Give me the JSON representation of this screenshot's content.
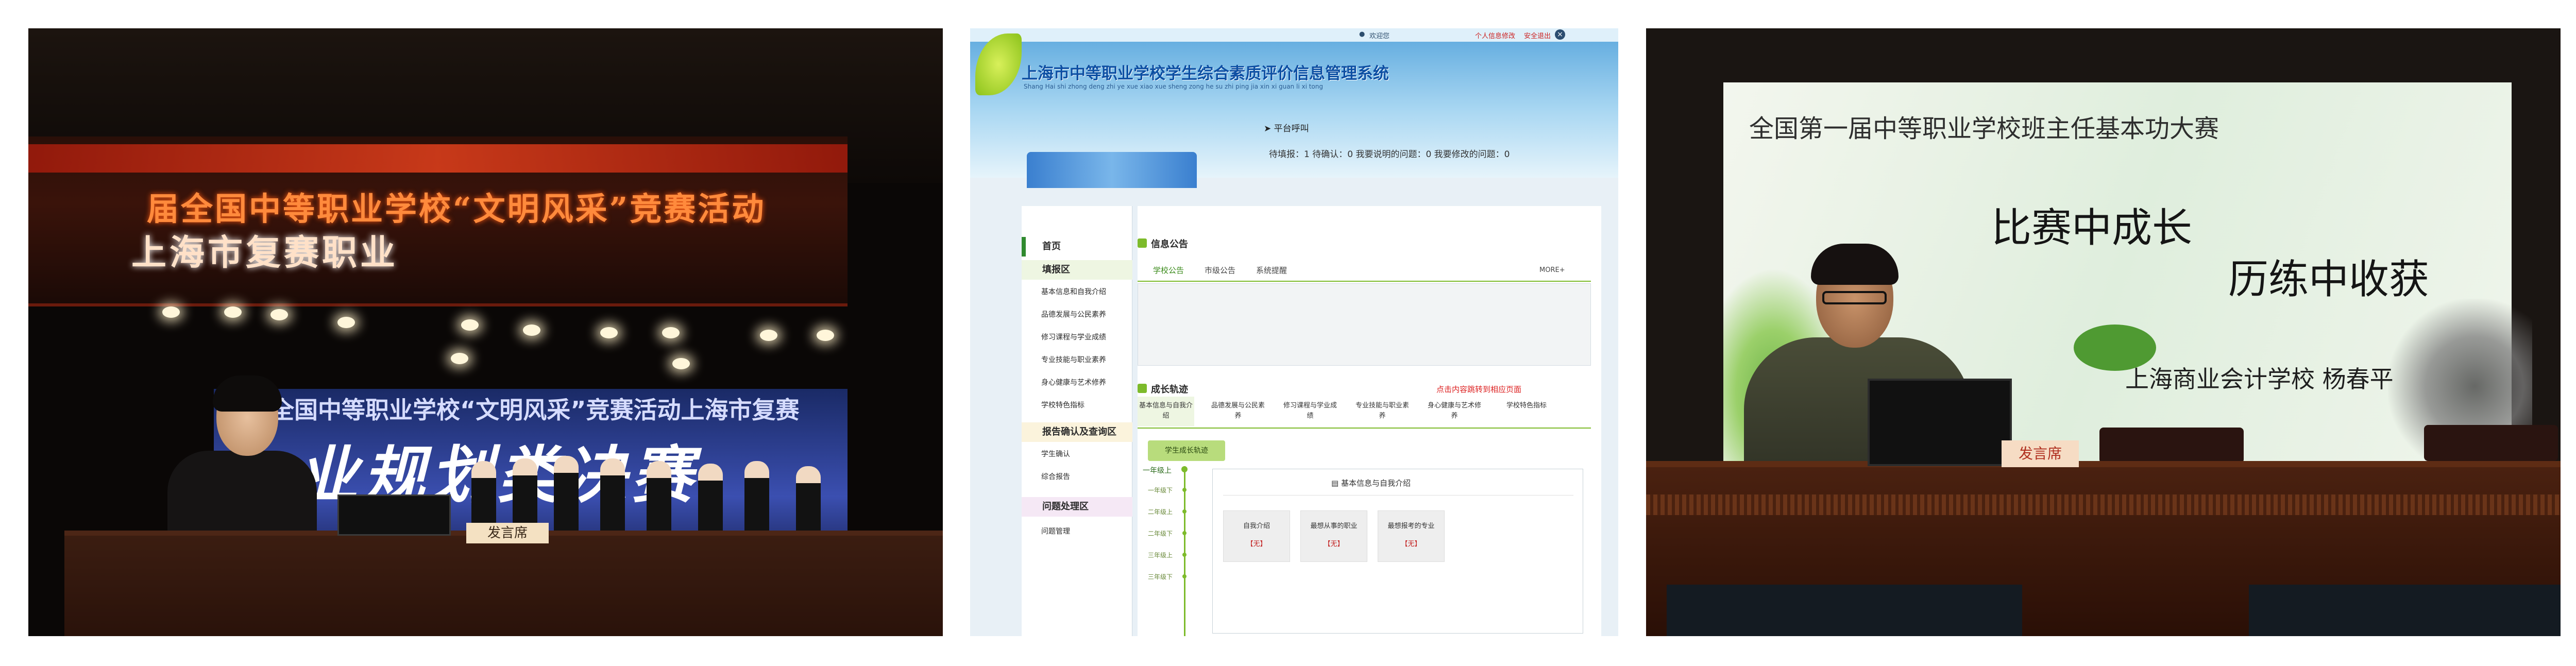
{
  "photo_left": {
    "banner_line1": "届全国中等职业学校“文明风采”竞赛活动",
    "banner_line2": "上海市复赛职业",
    "screen_line1": "全国中等职业学校“文明风采”竞赛活动上海市复赛",
    "screen_line2": "业规划类决赛",
    "nameplate": "发言席"
  },
  "web_ui": {
    "topbar": {
      "welcome": "欢迎您",
      "user": "",
      "personal_info": "个人信息修改",
      "logout": "安全退出"
    },
    "title": "上海市中等职业学校学生综合素质评价信息管理系统",
    "pinyin": "Shang Hai shi zhong deng zhi ye xue xiao xue sheng zong he su zhi ping jia xin xi guan li xi tong",
    "notice": "平台呼叫",
    "status": "待填报：1  待确认：0  我要说明的问题：0  我要修改的问题：0",
    "nav": {
      "home": "首页",
      "fill_area": "填报区",
      "fill_items": [
        "基本信息和自我介绍",
        "品德发展与公民素养",
        "修习课程与学业成绩",
        "专业技能与职业素养",
        "身心健康与艺术修养",
        "学校特色指标"
      ],
      "confirm_area": "报告确认及查询区",
      "confirm_items": [
        "学生确认",
        "综合报告"
      ],
      "issue_area": "问题处理区",
      "issue_items": [
        "问题管理"
      ]
    },
    "info": {
      "heading": "信息公告",
      "tabs": [
        "学校公告",
        "市级公告",
        "系统提醒"
      ],
      "more": "MORE+"
    },
    "growth": {
      "heading": "成长轨迹",
      "hint": "点击内容跳转到相应页面",
      "tabs": [
        "基本信息与自我介绍",
        "品德发展与公民素养",
        "修习课程与学业成绩",
        "专业技能与职业素养",
        "身心健康与艺术修养",
        "学校特色指标"
      ],
      "badge": "学生成长轨迹",
      "timeline": [
        "一年级上",
        "一年级下",
        "二年级上",
        "二年级下",
        "三年级上",
        "三年级下"
      ],
      "panel_title": "基本信息与自我介绍",
      "cards": [
        {
          "label": "自我介绍",
          "value": "【无】"
        },
        {
          "label": "最想从事的职业",
          "value": "【无】"
        },
        {
          "label": "最想报考的专业",
          "value": "【无】"
        }
      ]
    }
  },
  "photo_right": {
    "slide_line1": "全国第一届中等职业学校班主任基本功大赛",
    "slide_line2": "比赛中成长",
    "slide_line3": "历练中收获",
    "slide_line4": "上海商业会计学校   杨春平",
    "nameplate": "发言席"
  }
}
